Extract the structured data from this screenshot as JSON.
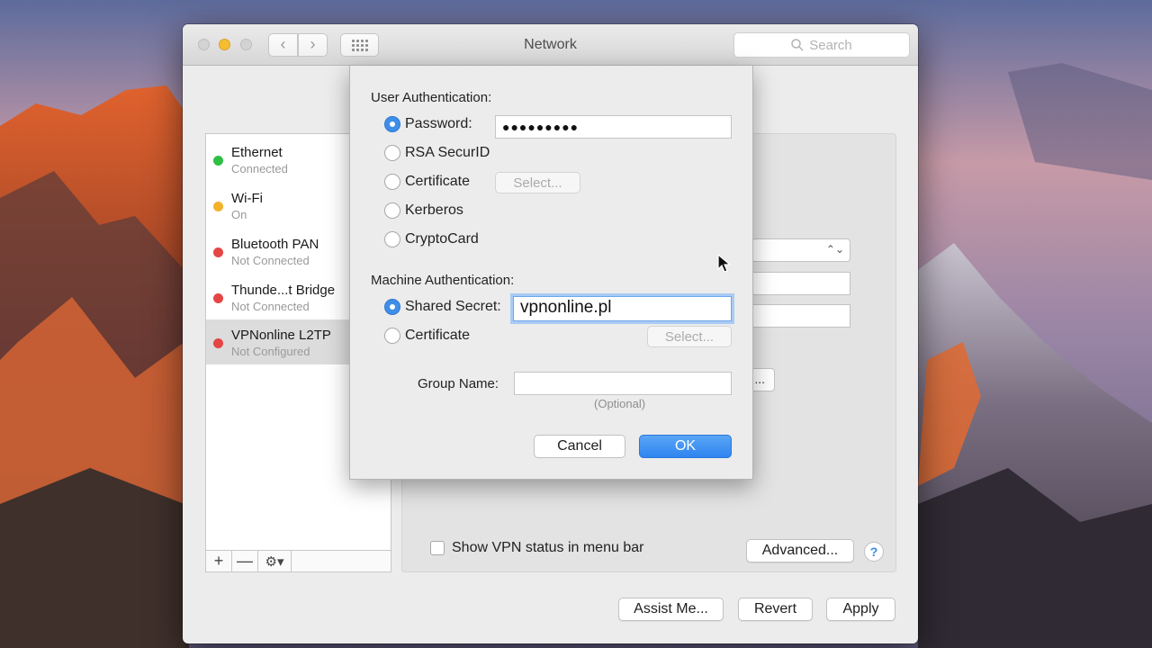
{
  "window": {
    "title": "Network",
    "search_placeholder": "Search"
  },
  "services": [
    {
      "name": "Ethernet",
      "status": "Connected",
      "color": "#2fbf45"
    },
    {
      "name": "Wi-Fi",
      "status": "On",
      "color": "#f2b22b"
    },
    {
      "name": "Bluetooth PAN",
      "status": "Not Connected",
      "color": "#e64545"
    },
    {
      "name": "Thunde...t Bridge",
      "status": "Not Connected",
      "color": "#e64545"
    },
    {
      "name": "VPNonline L2TP",
      "status": "Not Configured",
      "color": "#e64545",
      "selected": true
    }
  ],
  "sidebar_tools": {
    "add": "+",
    "remove": "—",
    "gear": "⚙▾"
  },
  "detail": {
    "show_vpn_status_label": "Show VPN status in menu bar",
    "show_vpn_status_checked": false,
    "advanced_button": "Advanced...",
    "help_button": "?",
    "ghost_button_tail": "..."
  },
  "footer": {
    "assist_button": "Assist Me...",
    "revert_button": "Revert",
    "apply_button": "Apply"
  },
  "sheet": {
    "user_auth_title": "User Authentication:",
    "user_options": [
      {
        "label": "Password:",
        "selected": true
      },
      {
        "label": "RSA SecurID",
        "selected": false
      },
      {
        "label": "Certificate",
        "selected": false
      },
      {
        "label": "Kerberos",
        "selected": false
      },
      {
        "label": "CryptoCard",
        "selected": false
      }
    ],
    "password_value": "●●●●●●●●●",
    "user_cert_select": "Select...",
    "machine_auth_title": "Machine Authentication:",
    "machine_options": [
      {
        "label": "Shared Secret:",
        "selected": true
      },
      {
        "label": "Certificate",
        "selected": false
      }
    ],
    "shared_secret_value": "vpnonline.pl",
    "machine_cert_select": "Select...",
    "group_name_label": "Group Name:",
    "group_name_value": "",
    "optional_hint": "(Optional)",
    "cancel_button": "Cancel",
    "ok_button": "OK"
  },
  "colors": {
    "accent": "#3f8ee8",
    "traffic_yellow": "#f5be30"
  }
}
